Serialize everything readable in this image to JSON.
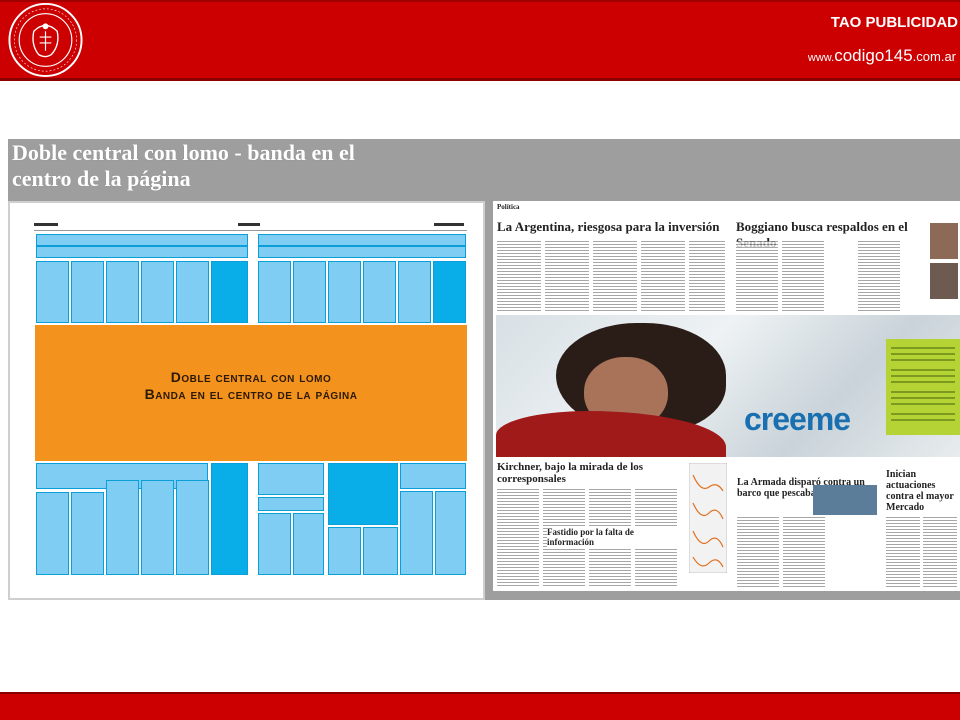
{
  "header": {
    "brand": "TAO PUBLICIDAD",
    "url_prefix": "www.",
    "url_main": "codigo145",
    "url_suffix": ".com.ar",
    "seal_icon": "university-seal-icon",
    "background": "#cc0000"
  },
  "slide_image": {
    "title_line1": "Doble central con lomo - banda en el",
    "title_line2": "centro de la página",
    "band_line1": "Doble central con lomo",
    "band_line2": "Banda en el centro de la página",
    "band_color": "#f4921e",
    "block_color": "#7fcdf2",
    "block_dark_color": "#09aee9"
  },
  "newspaper": {
    "headline_left": "La Argentina, riesgosa para la inversión",
    "headline_right": "Boggiano busca respaldos en el Senado",
    "headline_bottom_left": "Kirchner, bajo la mirada de los corresponsales",
    "headline_bottom_sub": "Fastidio por la falta de información",
    "headline_mid_right": "La Armada disparó contra un barco que pescaba ilegalmente",
    "headline_far_right": "Inician actuaciones contra el mayor Mercado",
    "section_label": "Política",
    "ad_logo": "creeme"
  },
  "footer": {
    "background": "#cc0000"
  }
}
